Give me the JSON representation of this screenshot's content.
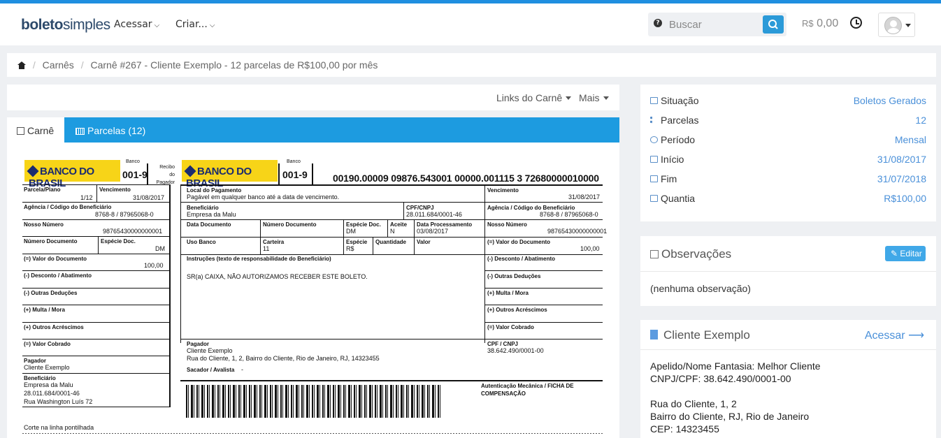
{
  "nav": {
    "logo_bold": "boleto",
    "logo_light": "simples",
    "menu": [
      {
        "label": "Acessar"
      },
      {
        "label": "Criar..."
      }
    ],
    "search": {
      "placeholder": "Buscar",
      "help": "?"
    },
    "balance_currency": "R$",
    "balance_value": "0,00"
  },
  "breadcrumb": {
    "items": [
      "Carnês",
      "Carnê #267 - Cliente Exemplo - 12 parcelas de R$100,00 por mês"
    ]
  },
  "toolbar": {
    "links_label": "Links do Carnê",
    "more_label": "Mais"
  },
  "tabs": [
    {
      "label": "Carnê"
    },
    {
      "label": "Parcelas (12)"
    }
  ],
  "boleto": {
    "bank_name": "BANCO DO BRASIL",
    "bank_label": "Banco",
    "bank_code": "001-9",
    "receipt_label": "Recibo do Pagador",
    "digitable_line": "00190.00009 09876.543001 00000.001115 3 72680000010000",
    "stub": {
      "parcela_label": "Parcela/Plano",
      "parcela_value": "1/12",
      "vencimento_label": "Vencimento",
      "vencimento_value": "31/08/2017",
      "agencia_label": "Agência / Código do Beneficiário",
      "agencia_value": "8768-8 / 87965068-0",
      "nosso_label": "Nosso Número",
      "nosso_value": "98765430000000001",
      "numdoc_label": "Número Documento",
      "especie_label": "Espécie Doc.",
      "especie_value": "DM",
      "valor_label": "(=) Valor do Documento",
      "valor_value": "100,00",
      "desconto_label": "(-) Desconto / Abatimento",
      "deducoes_label": "(-) Outras Deduções",
      "multa_label": "(+) Multa / Mora",
      "acrescimos_label": "(+) Outros Acréscimos",
      "cobrado_label": "(=) Valor Cobrado",
      "pagador_label": "Pagador",
      "pagador_value": "Cliente Exemplo",
      "benef_label": "Beneficiário",
      "benef_name": "Empresa da Malu",
      "benef_cnpj": "28.011.684/0001-46",
      "benef_addr": "Rua Washington Luís 72",
      "cut_label": "Corte na linha pontilhada"
    },
    "main": {
      "local_label": "Local do Pagamento",
      "local_value": "Pagável em qualquer banco até a data de vencimento.",
      "benef_label": "Beneficiário",
      "benef_value": "Empresa da Malu",
      "cpf_label": "CPF/CNPJ",
      "cpf_value": "28.011.684/0001-46",
      "datadoc_label": "Data Documento",
      "numdoc_label": "Número Documento",
      "especie_label": "Espécie Doc.",
      "especie_value": "DM",
      "aceite_label": "Aceite",
      "aceite_value": "N",
      "dataproc_label": "Data Processamento",
      "dataproc_value": "03/08/2017",
      "usobanco_label": "Uso Banco",
      "carteira_label": "Carteira",
      "carteira_value": "11",
      "especie2_label": "Espécie",
      "especie2_value": "R$",
      "qtd_label": "Quantidade",
      "valor_label": "Valor",
      "instr_label": "Instruções (texto de responsabilidade do Beneficiário)",
      "instr_value": "SR(a) CAIXA, NÃO AUTORIZAMOS RECEBER ESTE BOLETO.",
      "pagador_label": "Pagador",
      "pagador_name": "Cliente Exemplo",
      "pagador_addr": "Rua do Cliente, 1, 2, Bairro do Cliente, Rio de Janeiro, RJ, 14323455",
      "sacador_label": "Sacador / Avalista",
      "sacador_value": "-",
      "cpf2_label": "CPF / CNPJ",
      "cpf2_value": "38.642.490/0001-00",
      "auth_label": "Autenticação Mecânica / FICHA DE COMPENSAÇÃO"
    }
  },
  "info": [
    {
      "key": "Situação",
      "value": "Boletos Gerados"
    },
    {
      "key": "Parcelas",
      "value": "12"
    },
    {
      "key": "Período",
      "value": "Mensal"
    },
    {
      "key": "Início",
      "value": "31/08/2017"
    },
    {
      "key": "Fim",
      "value": "31/07/2018"
    },
    {
      "key": "Quantia",
      "value": "R$100,00"
    }
  ],
  "observacoes": {
    "title": "Observações",
    "edit_label": "Editar",
    "body": "(nenhuma observação)"
  },
  "cliente": {
    "title": "Cliente Exemplo",
    "access_label": "Acessar",
    "apelido": "Apelido/Nome Fantasia: Melhor Cliente",
    "cnpj": "CNPJ/CPF: 38.642.490/0001-00",
    "addr1": "Rua do Cliente, 1, 2",
    "addr2": "Bairro do Cliente, RJ, Rio de Janeiro",
    "cep": "CEP: 14323455"
  },
  "colors": {
    "accent": "#1d9be0",
    "link": "#4a90d9",
    "bank_yellow": "#f7d418",
    "bank_blue": "#1a2b6f"
  }
}
